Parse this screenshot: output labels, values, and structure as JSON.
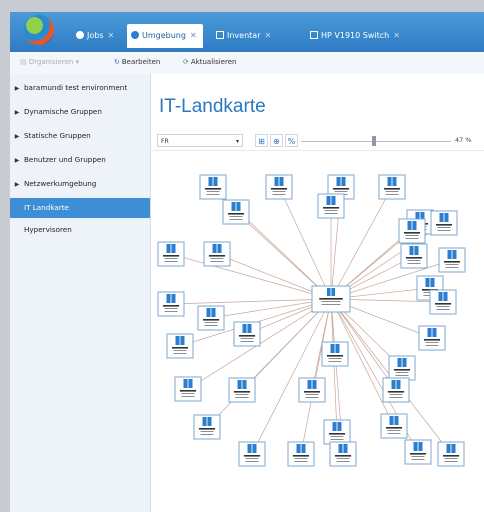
{
  "tabs": [
    {
      "label": "Jobs",
      "icon": "jobs-icon"
    },
    {
      "label": "Umgebung",
      "icon": "environment-icon"
    },
    {
      "label": "Inventar",
      "icon": "inventory-icon"
    },
    {
      "label": "HP V1910 Switch",
      "icon": "switch-icon"
    }
  ],
  "toolbar": {
    "organize": "Organisieren",
    "edit": "Bearbeiten",
    "refresh": "Aktualisieren"
  },
  "sidebar": {
    "items": [
      {
        "label": "baramundi test environment",
        "expandable": true,
        "selected": false
      },
      {
        "label": "Dynamische Gruppen",
        "expandable": true,
        "selected": false
      },
      {
        "label": "Statische Gruppen",
        "expandable": true,
        "selected": false
      },
      {
        "label": "Benutzer und Gruppen",
        "expandable": true,
        "selected": false
      },
      {
        "label": "Netzwerkumgebung",
        "expandable": true,
        "selected": false
      },
      {
        "label": "IT Landkarte",
        "expandable": false,
        "selected": true
      },
      {
        "label": "Hypervisoren",
        "expandable": false,
        "selected": false
      }
    ]
  },
  "main": {
    "title": "IT-Landkarte",
    "layout_select": "FR",
    "zoom": "47 %",
    "zoom_fraction": 0.47
  },
  "colors": {
    "accent": "#2b78c2",
    "selected": "#3e8ed6",
    "tabbar": "#2e7bc4"
  }
}
